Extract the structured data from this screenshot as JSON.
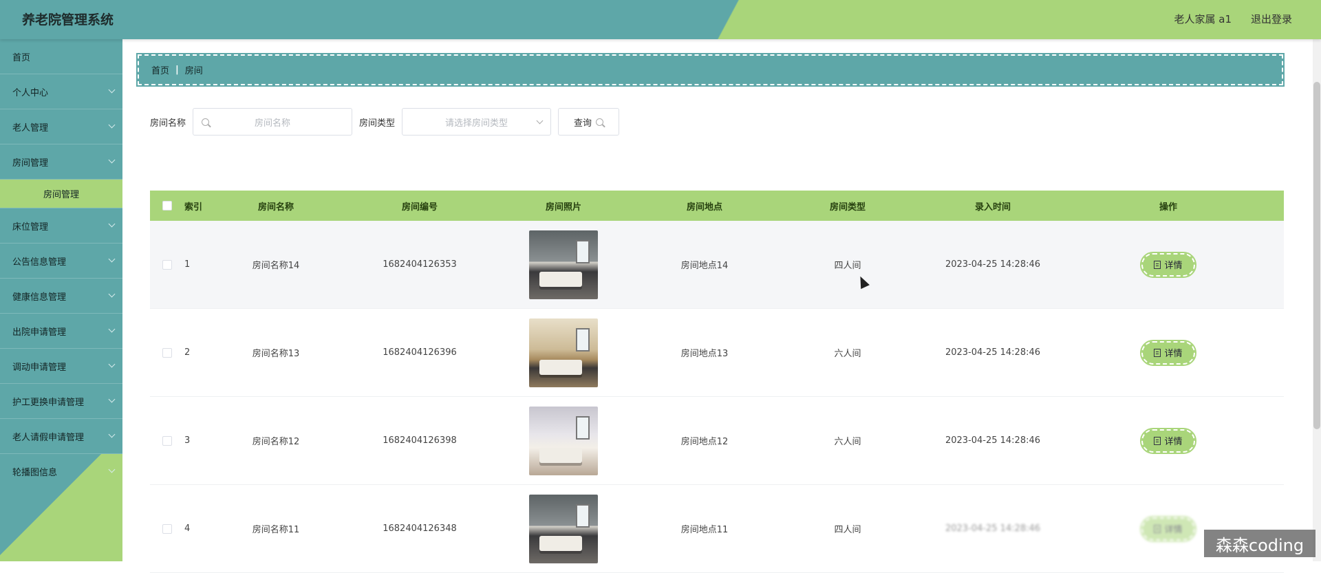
{
  "header": {
    "title": "养老院管理系统",
    "user": "老人家属 a1",
    "logout": "退出登录"
  },
  "sidebar": {
    "items": [
      {
        "label": "首页",
        "expandable": false
      },
      {
        "label": "个人中心",
        "expandable": true
      },
      {
        "label": "老人管理",
        "expandable": true
      },
      {
        "label": "房间管理",
        "expandable": true
      },
      {
        "label": "床位管理",
        "expandable": true
      },
      {
        "label": "公告信息管理",
        "expandable": true
      },
      {
        "label": "健康信息管理",
        "expandable": true
      },
      {
        "label": "出院申请管理",
        "expandable": true
      },
      {
        "label": "调动申请管理",
        "expandable": true
      },
      {
        "label": "护工更换申请管理",
        "expandable": true
      },
      {
        "label": "老人请假申请管理",
        "expandable": true
      },
      {
        "label": "轮播图信息",
        "expandable": true
      }
    ],
    "active_sub": "房间管理"
  },
  "breadcrumb": {
    "home": "首页",
    "current": "房间"
  },
  "search": {
    "name_label": "房间名称",
    "name_placeholder": "房间名称",
    "type_label": "房间类型",
    "type_placeholder": "请选择房间类型",
    "query_button": "查询"
  },
  "table": {
    "columns": [
      "索引",
      "房间名称",
      "房间编号",
      "房间照片",
      "房间地点",
      "房间类型",
      "录入时间",
      "操作"
    ],
    "rows": [
      {
        "index": "1",
        "name": "房间名称14",
        "number": "1682404126353",
        "location": "房间地点14",
        "type": "四人间",
        "time": "2023-04-25 14:28:46",
        "action": "详情"
      },
      {
        "index": "2",
        "name": "房间名称13",
        "number": "1682404126396",
        "location": "房间地点13",
        "type": "六人间",
        "time": "2023-04-25 14:28:46",
        "action": "详情"
      },
      {
        "index": "3",
        "name": "房间名称12",
        "number": "1682404126398",
        "location": "房间地点12",
        "type": "六人间",
        "time": "2023-04-25 14:28:46",
        "action": "详情"
      },
      {
        "index": "4",
        "name": "房间名称11",
        "number": "1682404126348",
        "location": "房间地点11",
        "type": "四人间",
        "time": "2023-04-25 14:28:46",
        "action": "详情"
      }
    ]
  },
  "watermark": "森森coding",
  "colors": {
    "primary": "#5ea7a8",
    "accent": "#a9d57a"
  }
}
